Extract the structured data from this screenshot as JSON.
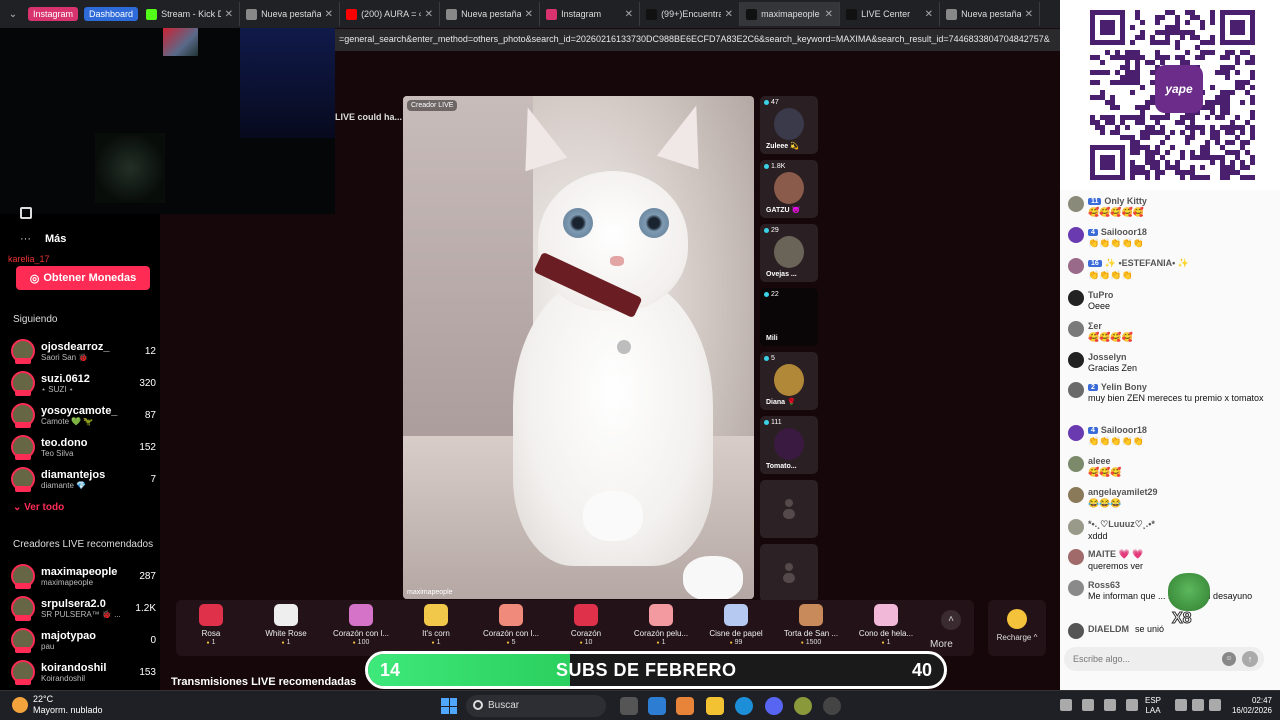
{
  "browser": {
    "pills": [
      "Instagram",
      "Dashboard"
    ],
    "tabs": [
      {
        "title": "Stream - Kick Da",
        "color": "#53fc18"
      },
      {
        "title": "Nueva pestaña",
        "color": "#888888"
      },
      {
        "title": "(200) AURA = ∞",
        "color": "#ff0000"
      },
      {
        "title": "Nueva pestaña",
        "color": "#888888"
      },
      {
        "title": "Instagram",
        "color": "#d8336d"
      },
      {
        "title": "(99+)Encuentra",
        "color": "#111111"
      },
      {
        "title": "maximapeople",
        "color": "#111111"
      },
      {
        "title": "LIVE Center",
        "color": "#111111"
      },
      {
        "title": "Nueva pestaña",
        "color": "#888888"
      }
    ],
    "url": "=general_search&enter_method=others_photo&search_id=20260216133730DC988BE6ECFD7A83E2C6&search_keyword=MAXIMA&search_result_id=7446833804704842757&"
  },
  "sidebar": {
    "mas_label": "Más",
    "karelia": "karelia_17",
    "coins_button": "Obtener Monedas",
    "following_title": "Siguiendo",
    "following": [
      {
        "name": "ojosdearroz_",
        "sub": "Saori San 🐞",
        "count": "12"
      },
      {
        "name": "suzi.0612",
        "sub": "⋆ SUZI ⋆",
        "count": "320"
      },
      {
        "name": "yosoycamote_",
        "sub": "Camote 💚 🦖",
        "count": "87"
      },
      {
        "name": "teo.dono",
        "sub": "Teo Silva",
        "count": "152"
      },
      {
        "name": "diamantejos",
        "sub": "diamante 💎",
        "count": "7"
      }
    ],
    "see_all": "Ver todo",
    "recommended_title": "Creadores LIVE recomendados",
    "recommended": [
      {
        "name": "maximapeople",
        "sub": "maximapeople",
        "count": "287"
      },
      {
        "name": "srpulsera2.0",
        "sub": "SR PULSERA™ 🐞 ...",
        "count": "1.2K"
      },
      {
        "name": "majotypao",
        "sub": "pau",
        "count": "0"
      },
      {
        "name": "koirandoshil",
        "sub": "Koirandoshil",
        "count": "153"
      }
    ]
  },
  "stream": {
    "side_message": "LIVE could ha...",
    "tag": "Creador LIVE",
    "owner": "maximapeople"
  },
  "thumbnails": [
    {
      "viewers": "47",
      "name": "Zuleee 💫",
      "color": "#3a3a4a"
    },
    {
      "viewers": "1.8K",
      "name": "GATZU 😈",
      "color": "#8a5a4a"
    },
    {
      "viewers": "29",
      "name": "Ovejas ...",
      "color": "#6a6458"
    },
    {
      "viewers": "22",
      "name": "Mili",
      "color": "#000000"
    },
    {
      "viewers": "5",
      "name": "Diana 🌹",
      "color": "#b08838"
    },
    {
      "viewers": "111",
      "name": "Tomato...",
      "color": "#3a1a40"
    }
  ],
  "gifts": [
    {
      "name": "Rosa",
      "price": "1",
      "color": "#e0314a"
    },
    {
      "name": "White Rose",
      "price": "1",
      "color": "#eeeeee"
    },
    {
      "name": "Corazón con l...",
      "price": "100",
      "color": "#d473c8"
    },
    {
      "name": "It's corn",
      "price": "1",
      "color": "#f2c84b"
    },
    {
      "name": "Corazón con l...",
      "price": "5",
      "color": "#f08a7a"
    },
    {
      "name": "Corazón",
      "price": "10",
      "color": "#e0314a"
    },
    {
      "name": "Corazón pelu...",
      "price": "1",
      "color": "#f29aa0"
    },
    {
      "name": "Cisne de papel",
      "price": "99",
      "color": "#b6c9f0"
    },
    {
      "name": "Torta de San ...",
      "price": "1500",
      "color": "#c88a5a"
    },
    {
      "name": "Cono de hela...",
      "price": "1",
      "color": "#f2b8d8"
    }
  ],
  "more_label": "More",
  "recharge_label": "Recharge ^",
  "subs": {
    "current": "14",
    "label": "SUBS DE FEBRERO",
    "goal": "40",
    "progress": 0.35
  },
  "transmisiones": "Transmisiones LIVE recomendadas",
  "chat": {
    "messages": [
      {
        "user": "Only Kitty",
        "badge": "11",
        "badge_color": "#3b6bd8",
        "text": "🥰🥰🥰🥰🥰",
        "avatar": "#8a8a7a"
      },
      {
        "user": "Sailooor18",
        "badge": "4",
        "badge_color": "#3b6bd8",
        "text": "👏👏👏👏👏",
        "avatar": "#6a3ab0"
      },
      {
        "user": "✨ •ESTEFANIA• ✨",
        "badge": "16",
        "badge_color": "#3b6bd8",
        "text": "👏👏👏👏",
        "avatar": "#9a6a8a"
      },
      {
        "user": "TuPro",
        "badge": "",
        "badge_color": "",
        "text": "Oeee",
        "avatar": "#222222"
      },
      {
        "user": "Σer",
        "badge": "",
        "badge_color": "",
        "text": "🥰🥰🥰🥰",
        "avatar": "#7a7a7a"
      },
      {
        "user": "Josselyn",
        "badge": "",
        "badge_color": "",
        "text": "Gracias Zen",
        "avatar": "#222222"
      },
      {
        "user": "Yelin Bony",
        "badge": "2",
        "badge_color": "#3b6bd8",
        "text": "muy bien ZEN mereces tu premio x tomatox",
        "avatar": "#6a6a6a"
      },
      {
        "user": "Sailooor18",
        "badge": "4",
        "badge_color": "#3b6bd8",
        "text": "👏👏👏👏👏",
        "avatar": "#6a3ab0"
      },
      {
        "user": "aleee",
        "badge": "",
        "badge_color": "",
        "text": "🥰🥰🥰",
        "avatar": "#7a8a6a"
      },
      {
        "user": "angelayamilet29",
        "badge": "",
        "badge_color": "",
        "text": "😂😂😂",
        "avatar": "#8a7a5a"
      },
      {
        "user": "*•.¸♡Luuuz♡¸.•*",
        "badge": "",
        "badge_color": "",
        "text": "xddd",
        "avatar": "#9a9a8a"
      },
      {
        "user": "MAITE 💗 💗",
        "badge": "",
        "badge_color": "",
        "text": "queremos ver",
        "avatar": "#a06a6a"
      },
      {
        "user": "Ross63",
        "badge": "",
        "badge_color": "",
        "text": "Me informan que ... me para el desayuno",
        "avatar": "#8a8a8a"
      },
      {
        "user": "DIAELDM",
        "badge": "",
        "badge_color": "",
        "text": "se unió",
        "avatar": "#555555"
      }
    ],
    "input_placeholder": "Escribe algo...",
    "x8": "X8"
  },
  "taskbar": {
    "temp": "22°C",
    "weather": "Mayorm. nublado",
    "search": "Buscar",
    "lang1": "ESP",
    "lang2": "LAA",
    "time": "02:47",
    "date": "16/02/2026"
  }
}
